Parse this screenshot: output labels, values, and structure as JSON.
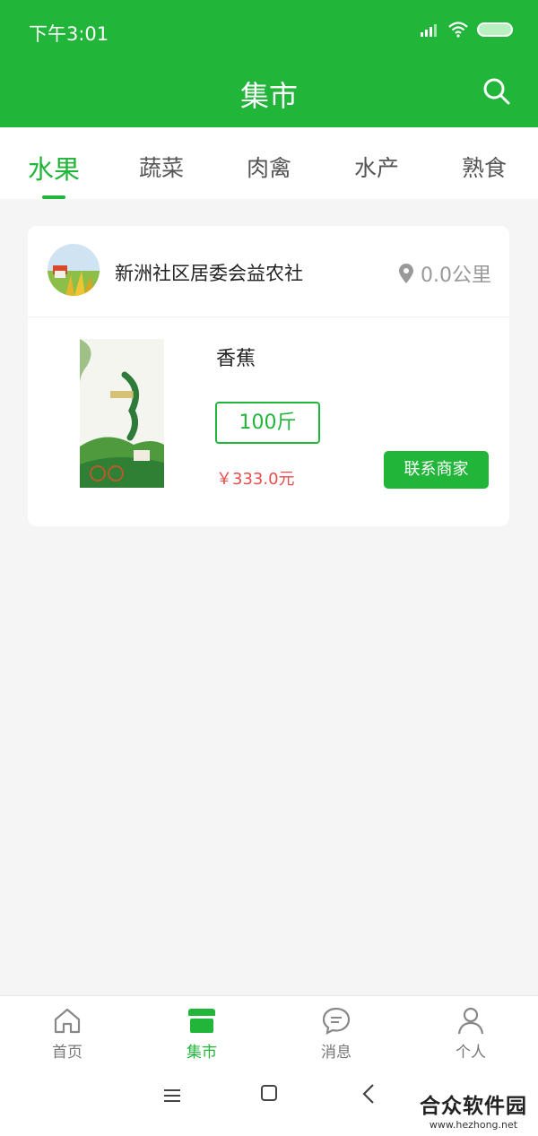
{
  "status": {
    "time": "下午3:01"
  },
  "header": {
    "title": "集市"
  },
  "tabs": [
    "水果",
    "蔬菜",
    "肉禽",
    "水产",
    "熟食"
  ],
  "card": {
    "store_name": "新洲社区居委会益农社",
    "distance": "0.0公里",
    "product_name": "香蕉",
    "quantity": "100斤",
    "price": "￥333.0元",
    "contact_label": "联系商家"
  },
  "bottom_nav": [
    "首页",
    "集市",
    "消息",
    "个人"
  ],
  "watermark": {
    "main": "合众软件园",
    "sub": "www.hezhong.net"
  },
  "colors": {
    "brand": "#21b53a",
    "price": "#e94c4c"
  }
}
